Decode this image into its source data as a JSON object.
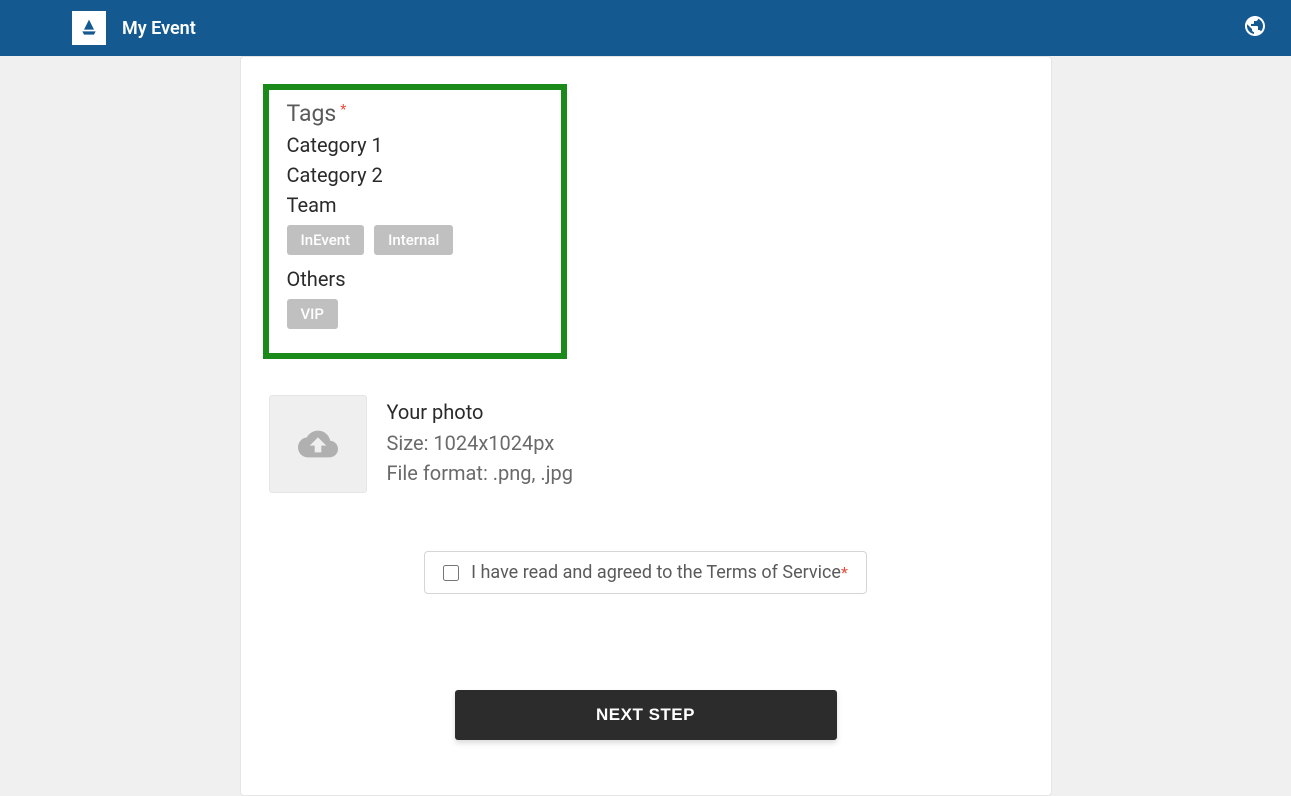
{
  "header": {
    "title": "My Event"
  },
  "tags": {
    "label": "Tags",
    "categories": [
      {
        "label": "Category 1",
        "tags": []
      },
      {
        "label": "Category 2",
        "tags": []
      },
      {
        "label": "Team",
        "tags": [
          "InEvent",
          "Internal"
        ]
      },
      {
        "label": "Others",
        "tags": [
          "VIP"
        ]
      }
    ]
  },
  "upload": {
    "title": "Your photo",
    "size_line": "Size: 1024x1024px",
    "format_line": "File format: .png, .jpg"
  },
  "terms": {
    "text": "I have read and agreed to the Terms of Service"
  },
  "buttons": {
    "next": "NEXT STEP"
  }
}
